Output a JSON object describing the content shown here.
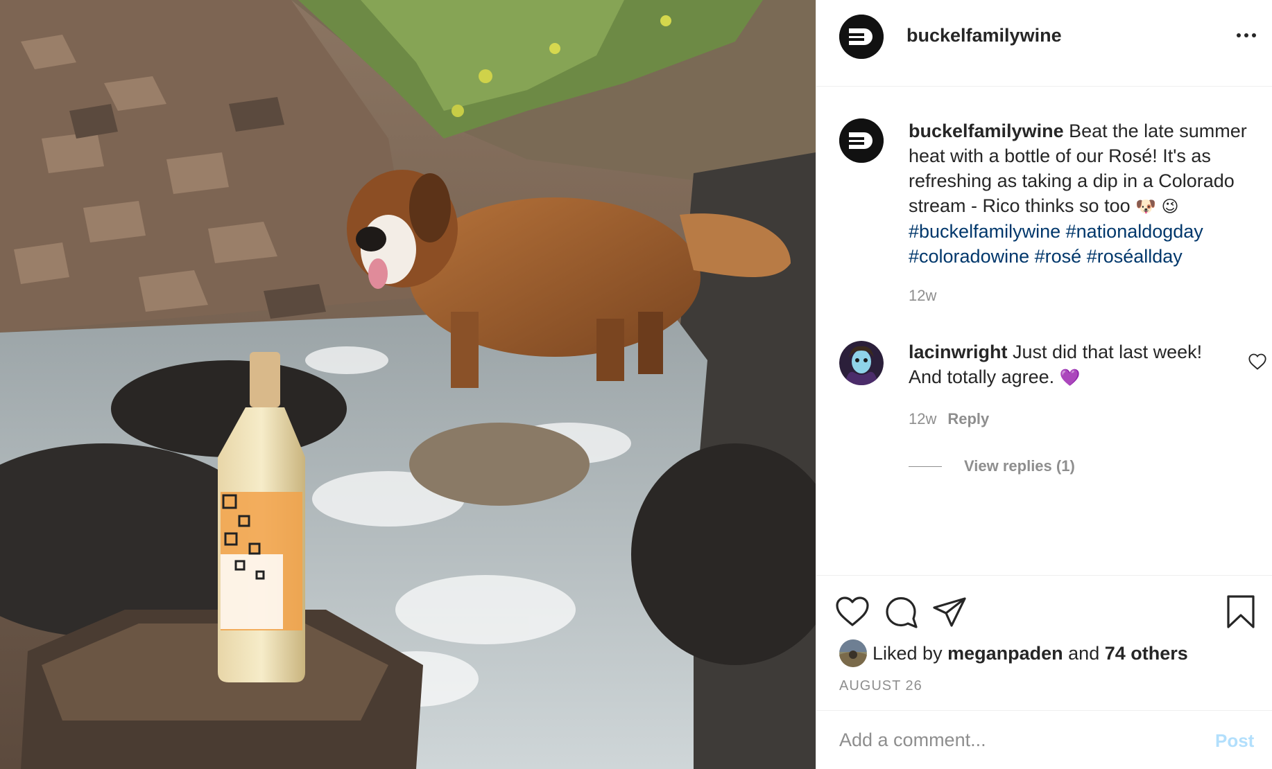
{
  "post": {
    "author": "buckelfamilywine",
    "caption": {
      "username": "buckelfamilywine",
      "line1": " Beat the late summer heat with a bottle of our Rosé! It's as refreshing as taking a dip in a Colorado stream - Rico thinks so too ",
      "emoji_dog": "🐶",
      "emoji_wink": "😉",
      "hashtags": [
        "#buckelfamilywine",
        "#nationaldogday",
        "#coloradowine",
        "#rosé",
        "#roséallday"
      ],
      "time": "12w"
    },
    "comments": [
      {
        "username": "lacinwright",
        "text": " Just did that last week! And totally agree. ",
        "emoji": "💜",
        "time": "12w",
        "reply_label": "Reply",
        "view_replies": "View replies (1)"
      }
    ],
    "likes": {
      "prefix": "Liked by ",
      "user": "meganpaden",
      "middle": " and ",
      "others": "74 others"
    },
    "date": "AUGUST 26",
    "add_comment_placeholder": "Add a comment...",
    "post_button": "Post"
  },
  "icons": [
    "more-icon",
    "heart-icon",
    "comment-icon",
    "share-icon",
    "bookmark-icon"
  ],
  "colors": {
    "hashtag": "#00376b",
    "meta": "#8e8e8e",
    "post_button_disabled": "#b2dffc"
  }
}
